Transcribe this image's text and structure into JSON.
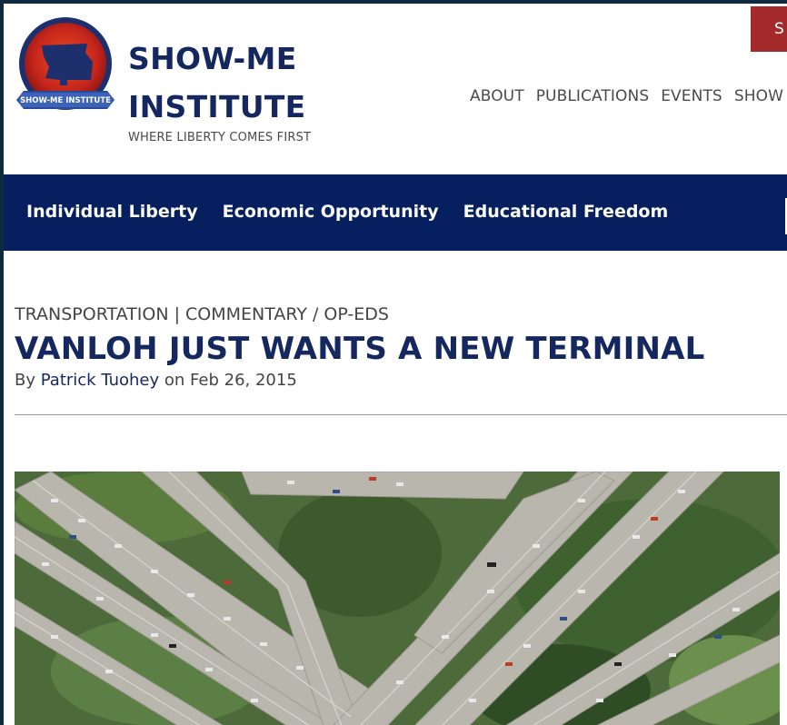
{
  "site": {
    "name_line1": "SHOW-ME",
    "name_line2": "INSTITUTE",
    "tagline": "WHERE LIBERTY COMES FIRST",
    "seal_text": "SHOW-ME INSTITUTE",
    "search_label": "S"
  },
  "top_nav": [
    "ABOUT",
    "PUBLICATIONS",
    "EVENTS",
    "SHOW"
  ],
  "main_nav": [
    "Individual Liberty",
    "Economic Opportunity",
    "Educational Freedom"
  ],
  "article": {
    "category": "TRANSPORTATION",
    "separator": "|",
    "type": "COMMENTARY / OP-EDS",
    "title": "VANLOH JUST WANTS A NEW TERMINAL",
    "by": "By",
    "author": "Patrick Tuohey",
    "on": "on Feb 26, 2015"
  },
  "colors": {
    "brand_navy": "#14285f",
    "nav_bg": "#06205f",
    "search_red": "#a3292b"
  }
}
